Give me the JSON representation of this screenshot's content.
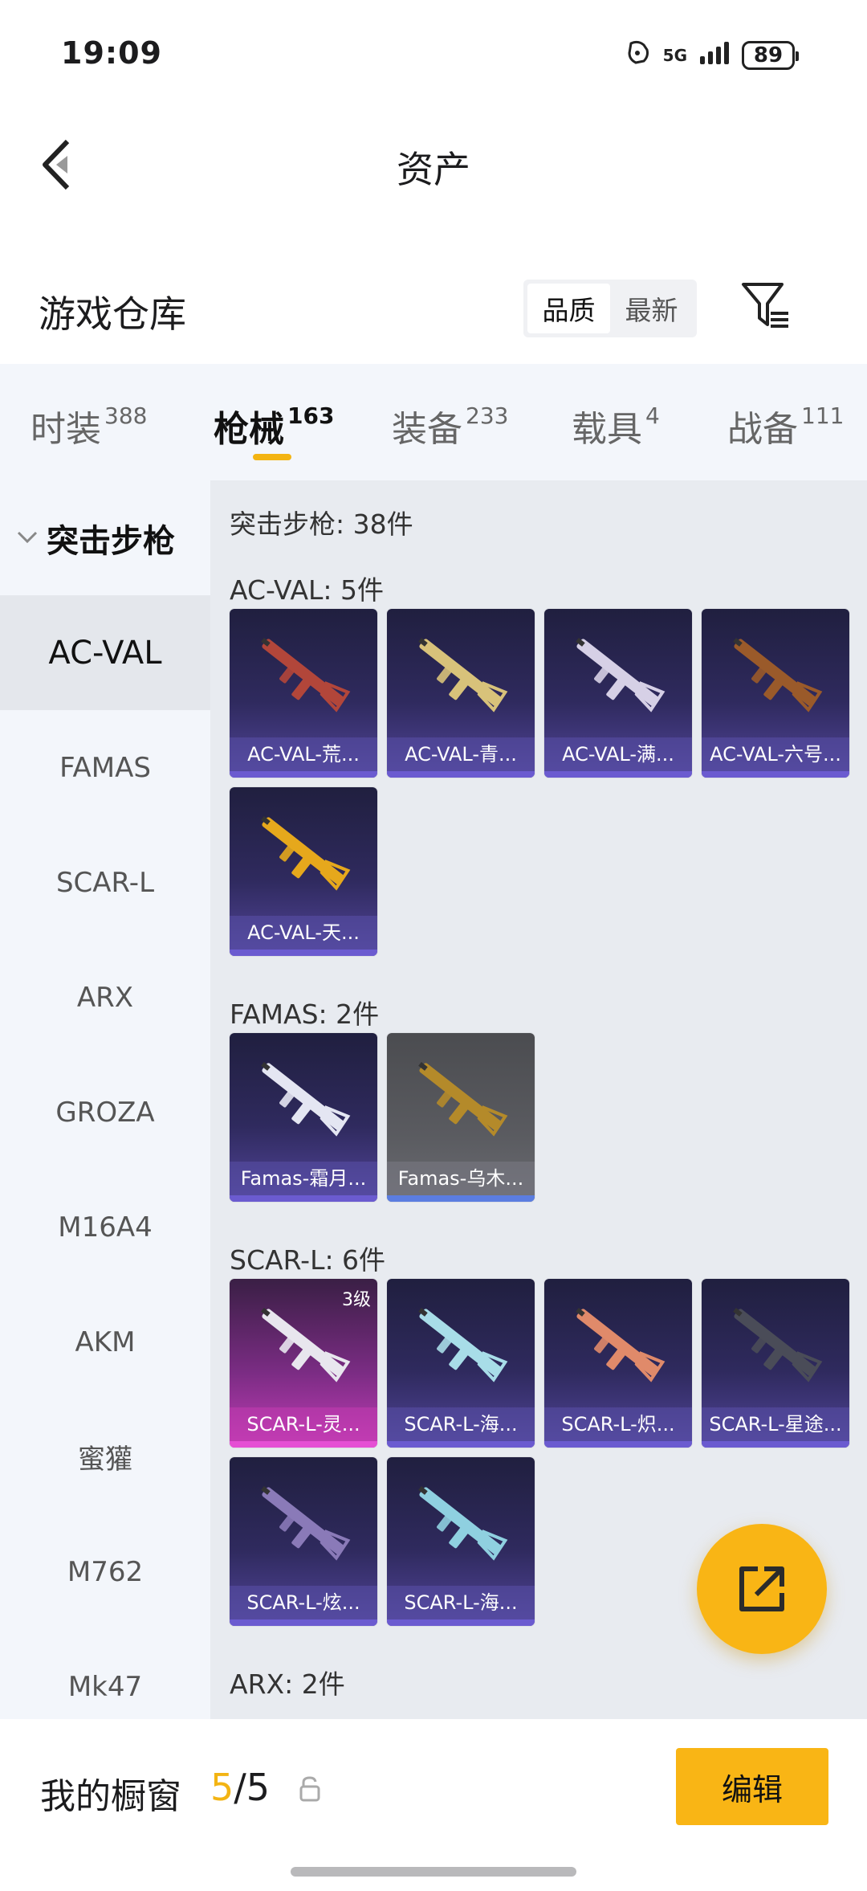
{
  "status_bar": {
    "time": "19:09",
    "network": "5G",
    "battery": "89"
  },
  "header": {
    "title": "资产"
  },
  "section": {
    "title": "游戏仓库",
    "sort_options": [
      "品质",
      "最新"
    ],
    "sort_active": 0
  },
  "tabs": [
    {
      "label": "时装",
      "count": "388"
    },
    {
      "label": "枪械",
      "count": "163"
    },
    {
      "label": "装备",
      "count": "233"
    },
    {
      "label": "载具",
      "count": "4"
    },
    {
      "label": "战备",
      "count": "111"
    }
  ],
  "active_tab": 1,
  "sidebar": {
    "group": "突击步枪",
    "items": [
      "AC-VAL",
      "FAMAS",
      "SCAR-L",
      "ARX",
      "GROZA",
      "M16A4",
      "AKM",
      "蜜獾",
      "M762",
      "Mk47"
    ],
    "active": 0
  },
  "content": {
    "category_title": "突击步枪: 38件",
    "groups": [
      {
        "title": "AC-VAL: 5件",
        "items": [
          {
            "name": "AC-VAL-荒...",
            "quality": "purple",
            "color": "#b2463a"
          },
          {
            "name": "AC-VAL-青...",
            "quality": "purple",
            "color": "#d8c27a"
          },
          {
            "name": "AC-VAL-满...",
            "quality": "purple",
            "color": "#d6d0e6"
          },
          {
            "name": "AC-VAL-六号...",
            "quality": "purple",
            "color": "#9a5a2a"
          },
          {
            "name": "AC-VAL-天...",
            "quality": "purple",
            "color": "#e6a81c"
          }
        ]
      },
      {
        "title": "FAMAS: 2件",
        "items": [
          {
            "name": "Famas-霜月...",
            "quality": "purple",
            "color": "#e4e6f2"
          },
          {
            "name": "Famas-乌木...",
            "quality": "grey",
            "color": "#b48a2a"
          }
        ]
      },
      {
        "title": "SCAR-L: 6件",
        "items": [
          {
            "name": "SCAR-L-灵...",
            "quality": "pink",
            "color": "#e8e6ee",
            "level": "3级"
          },
          {
            "name": "SCAR-L-海...",
            "quality": "purple",
            "color": "#a8dde8"
          },
          {
            "name": "SCAR-L-炽...",
            "quality": "purple",
            "color": "#e08a6a"
          },
          {
            "name": "SCAR-L-星途...",
            "quality": "purple",
            "color": "#4a4c58"
          },
          {
            "name": "SCAR-L-炫...",
            "quality": "purple",
            "color": "#8a7ab8"
          },
          {
            "name": "SCAR-L-海...",
            "quality": "purple",
            "color": "#8fd0e0"
          }
        ]
      },
      {
        "title": "ARX: 2件",
        "items": []
      }
    ]
  },
  "bottom_bar": {
    "label": "我的橱窗",
    "count_current": "5",
    "count_total": "/5",
    "edit_label": "编辑"
  },
  "colors": {
    "accent": "#f9b515",
    "tab_underline": "#f3b413"
  }
}
